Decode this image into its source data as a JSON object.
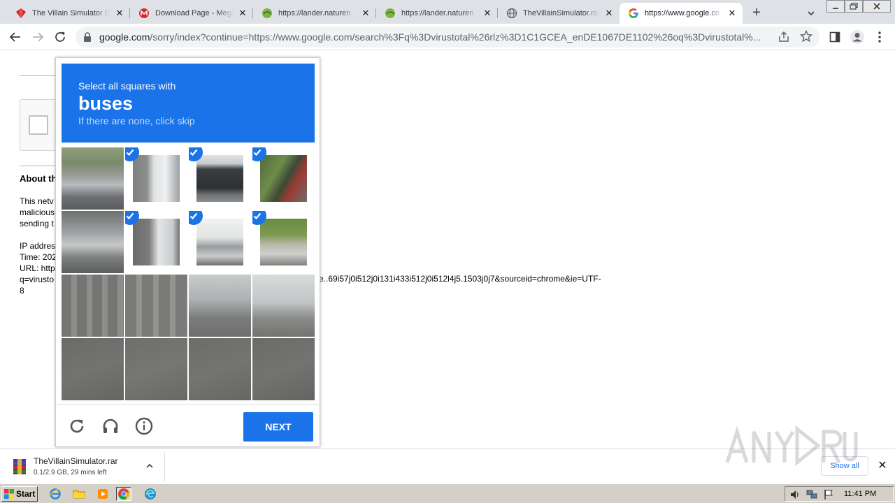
{
  "browser": {
    "tabs": [
      {
        "title": "The Villain Simulator Do",
        "icon": "red-gem-icon",
        "active": false
      },
      {
        "title": "Download Page - Mega",
        "icon": "mega-icon",
        "active": false
      },
      {
        "title": "https://lander.naturen",
        "icon": "globe-leaf-icon",
        "active": false
      },
      {
        "title": "https://lander.naturen",
        "icon": "globe-leaf-icon",
        "active": false
      },
      {
        "title": "TheVillainSimulator.rar",
        "icon": "globe-icon",
        "active": false
      },
      {
        "title": "https://www.google.co",
        "icon": "google-icon",
        "active": true
      }
    ],
    "new_tab": "+",
    "address": {
      "host": "google.com",
      "path": "/sorry/index?continue=https://www.google.com/search%3Fq%3Dvirustotal%26rlz%3D1C1GCEA_enDE1067DE1102%26oq%3Dvirustotal%..."
    }
  },
  "page": {
    "about_heading": "About th",
    "lines": [
      "This netv",
      "malicious",
      "sending t",
      "",
      "IP addres",
      "Time: 202",
      "URL: http",
      "q=virusto",
      "8"
    ],
    "url_tail": "e..69i57j0i512j0i131i433i512j0i512l4j5.1503j0j7&sourceid=chrome&ie=UTF-"
  },
  "captcha": {
    "instruction": "Select all squares with",
    "target": "buses",
    "hint": "If there are none, click skip",
    "next_label": "NEXT",
    "selected_tiles": [
      1,
      2,
      3,
      5,
      6,
      7
    ]
  },
  "download": {
    "filename": "TheVillainSimulator.rar",
    "status": "0.1/2.9 GB, 29 mins left",
    "show_all": "Show all"
  },
  "taskbar": {
    "start_label": "Start",
    "clock": "11:41 PM"
  },
  "colors": {
    "captcha_blue": "#1a73e8",
    "taskbar": "#d4d0c8"
  }
}
